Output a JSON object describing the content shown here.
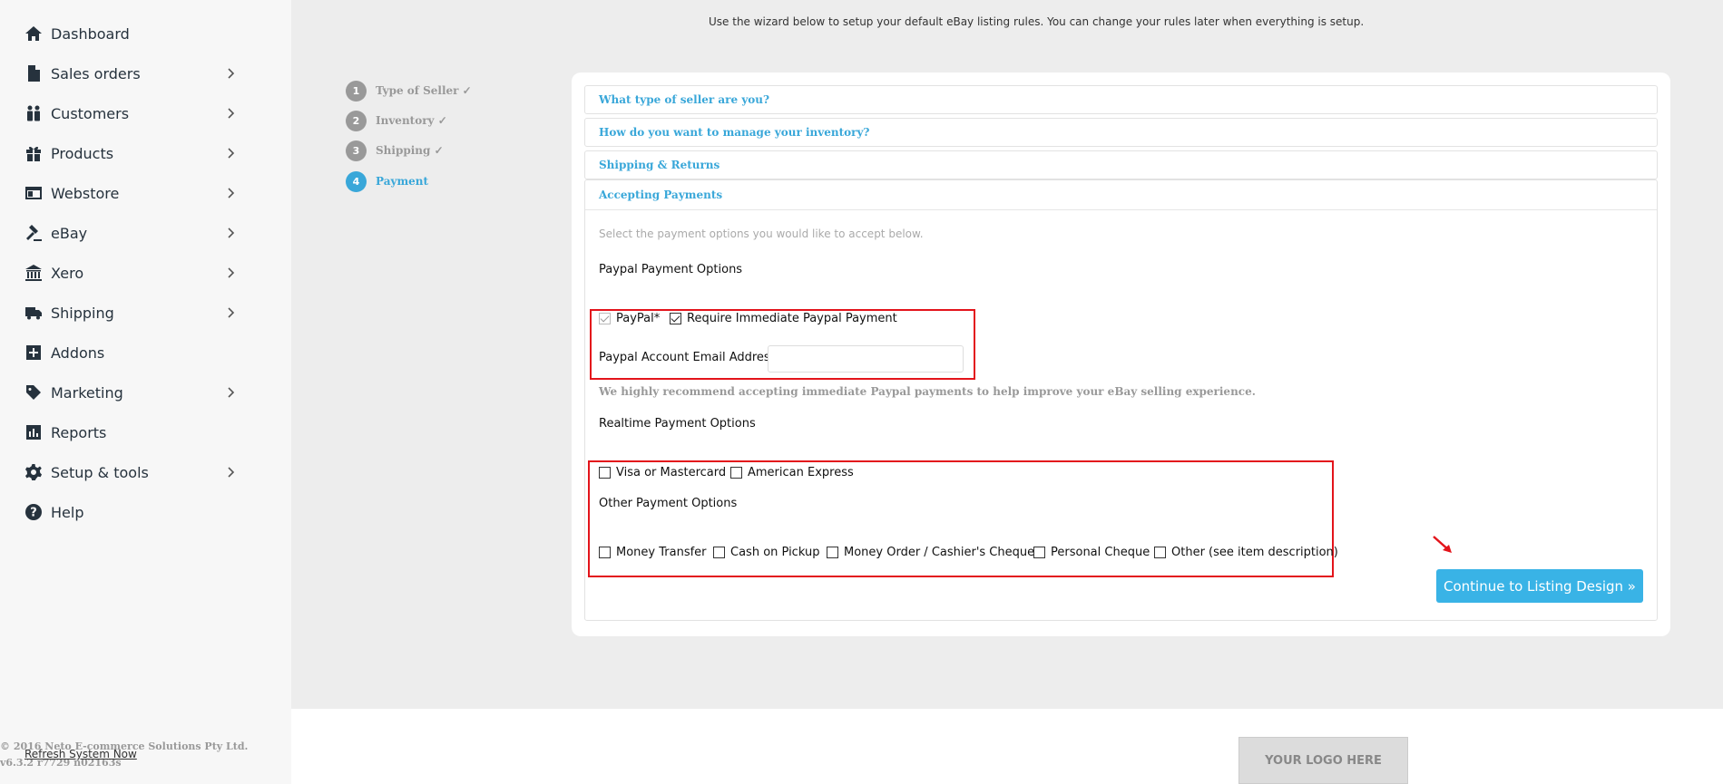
{
  "sidebar": {
    "items": [
      {
        "label": "Dashboard",
        "icon": "home-icon",
        "chevron": false
      },
      {
        "label": "Sales orders",
        "icon": "document-icon",
        "chevron": true
      },
      {
        "label": "Customers",
        "icon": "people-icon",
        "chevron": true
      },
      {
        "label": "Products",
        "icon": "gift-icon",
        "chevron": true
      },
      {
        "label": "Webstore",
        "icon": "browser-window-icon",
        "chevron": true
      },
      {
        "label": "eBay",
        "icon": "gavel-icon",
        "chevron": true
      },
      {
        "label": "Xero",
        "icon": "bank-icon",
        "chevron": true
      },
      {
        "label": "Shipping",
        "icon": "truck-icon",
        "chevron": true
      },
      {
        "label": "Addons",
        "icon": "plus-square-icon",
        "chevron": false
      },
      {
        "label": "Marketing",
        "icon": "tag-icon",
        "chevron": true
      },
      {
        "label": "Reports",
        "icon": "bar-chart-icon",
        "chevron": false
      },
      {
        "label": "Setup & tools",
        "icon": "gear-icon",
        "chevron": true
      },
      {
        "label": "Help",
        "icon": "question-circle-icon",
        "chevron": false
      }
    ]
  },
  "header": {
    "intro": "Use the wizard below to setup your default eBay listing rules. You can change your rules later when everything is setup."
  },
  "steps": [
    {
      "num": "1",
      "label": "Type of Seller ✓",
      "active": false
    },
    {
      "num": "2",
      "label": "Inventory ✓",
      "active": false
    },
    {
      "num": "3",
      "label": "Shipping ✓",
      "active": false
    },
    {
      "num": "4",
      "label": "Payment",
      "active": true
    }
  ],
  "accordion": {
    "seller": "What type of seller are you?",
    "inventory": "How do you want to manage your inventory?",
    "shipping": "Shipping & Returns",
    "payments": "Accepting Payments"
  },
  "payment": {
    "hint": "Select the payment options you would like to accept below.",
    "paypal_heading": "Paypal Payment Options",
    "paypal_label": "PayPal*",
    "paypal_checked": true,
    "require_immediate_label": "Require Immediate Paypal Payment",
    "require_immediate_checked": true,
    "email_label": "Paypal Account Email Address",
    "email_value": "",
    "recommendation": "We highly recommend accepting immediate Paypal payments to help improve your eBay selling experience.",
    "realtime_heading": "Realtime Payment Options",
    "visa_label": "Visa or Mastercard",
    "amex_label": "American Express",
    "other_heading": "Other Payment Options",
    "money_transfer": "Money Transfer",
    "cash_pickup": "Cash on Pickup",
    "money_order": "Money Order / Cashier's Cheque",
    "personal_cheque": "Personal Cheque",
    "other": "Other (see item description)",
    "continue_label": "Continue to Listing Design »"
  },
  "footer": {
    "copyright": "© 2016 Neto E-commerce Solutions Pty Ltd.",
    "version": "v6.3.2 r7729 n02163s",
    "refresh": "Refresh System Now",
    "logo": "YOUR LOGO HERE"
  },
  "colors": {
    "accent": "#39a7d9",
    "button": "#39b3e6",
    "highlight": "#e3141b"
  }
}
